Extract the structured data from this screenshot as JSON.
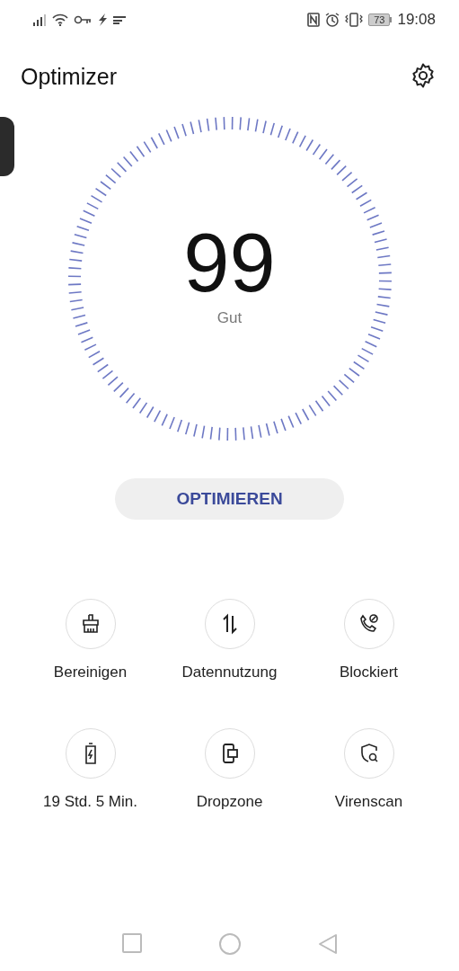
{
  "status_bar": {
    "battery": "73",
    "time": "19:08"
  },
  "header": {
    "title": "Optimizer"
  },
  "score": {
    "value": "99",
    "rating": "Gut"
  },
  "primary_button": {
    "label": "OPTIMIEREN"
  },
  "tools": [
    {
      "kind": "broom",
      "label": "Bereinigen"
    },
    {
      "kind": "data",
      "label": "Datennutzung"
    },
    {
      "kind": "blocked",
      "label": "Blockiert"
    },
    {
      "kind": "battery",
      "label": "19 Std. 5 Min."
    },
    {
      "kind": "dropzone",
      "label": "Dropzone"
    },
    {
      "kind": "virus",
      "label": "Virenscan"
    }
  ]
}
